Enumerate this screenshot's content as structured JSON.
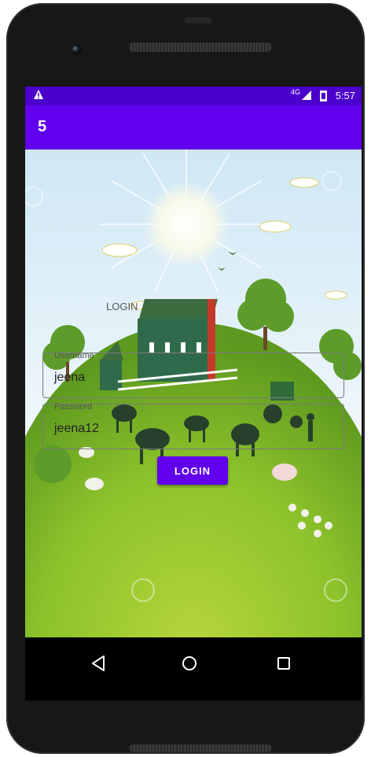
{
  "status_bar": {
    "network": "4G",
    "time": "5:57"
  },
  "app_bar": {
    "title": "5"
  },
  "login": {
    "heading": "LOGIN",
    "username_label": "Username",
    "username_value": "jeena",
    "password_label": "Password",
    "password_value": "jeena12",
    "button_label": "LOGIN"
  },
  "nav_bar": {
    "icons": [
      "back-icon",
      "home-icon",
      "recents-icon"
    ]
  },
  "colors": {
    "primary": "#6200ee",
    "primary_dark": "#4b00cc"
  }
}
